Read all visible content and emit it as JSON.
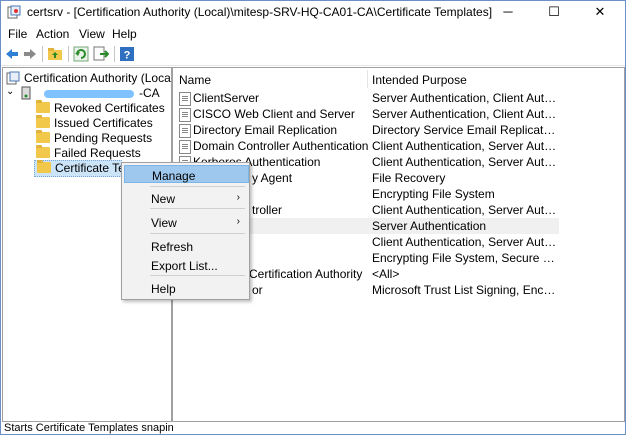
{
  "window": {
    "title": "certsrv - [Certification Authority (Local)\\mitesp-SRV-HQ-CA01-CA\\Certificate Templates]",
    "minimize": "─",
    "maximize": "☐",
    "close": "✕"
  },
  "menubar": {
    "file": "File",
    "action": "Action",
    "view": "View",
    "help": "Help"
  },
  "tree": {
    "root": "Certification Authority (Local)",
    "ca_suffix": "-CA",
    "items": [
      "Revoked Certificates",
      "Issued Certificates",
      "Pending Requests",
      "Failed Requests",
      "Certificate Tem"
    ]
  },
  "list": {
    "col_name": "Name",
    "col_purpose": "Intended Purpose",
    "rows": [
      {
        "name": "ClientServer",
        "purpose": "Server Authentication, Client Authentic..."
      },
      {
        "name": "CISCO  Web Client and Server",
        "purpose": "Server Authentication, Client Authentic..."
      },
      {
        "name": "Directory Email Replication",
        "purpose": "Directory Service Email Replication"
      },
      {
        "name": "Domain Controller Authentication",
        "purpose": "Client Authentication, Server Authentic..."
      },
      {
        "name": "Kerberos Authentication",
        "purpose": "Client Authentication, Server Authentic..."
      },
      {
        "name": "y Agent",
        "purpose": "File Recovery"
      },
      {
        "name": "",
        "purpose": "Encrypting File System"
      },
      {
        "name": "troller",
        "purpose": "Client Authentication, Server Authentic..."
      },
      {
        "name": "",
        "purpose": "Server Authentication"
      },
      {
        "name": "",
        "purpose": "Client Authentication, Server Authentic..."
      },
      {
        "name": "",
        "purpose": "Encrypting File System, Secure Email, Cl..."
      },
      {
        "name": "Certification Authority",
        "purpose": "<All>"
      },
      {
        "name": "or",
        "purpose": "Microsoft Trust List Signing, Encrypting..."
      }
    ]
  },
  "context_menu": {
    "manage": "Manage",
    "new": "New",
    "view": "View",
    "refresh": "Refresh",
    "export": "Export List...",
    "help": "Help",
    "arrow": "›"
  },
  "status": {
    "text": "Starts Certificate Templates snapin"
  },
  "colors": {
    "accent": "#1e73c8",
    "highlight": "#9fc8ee"
  }
}
